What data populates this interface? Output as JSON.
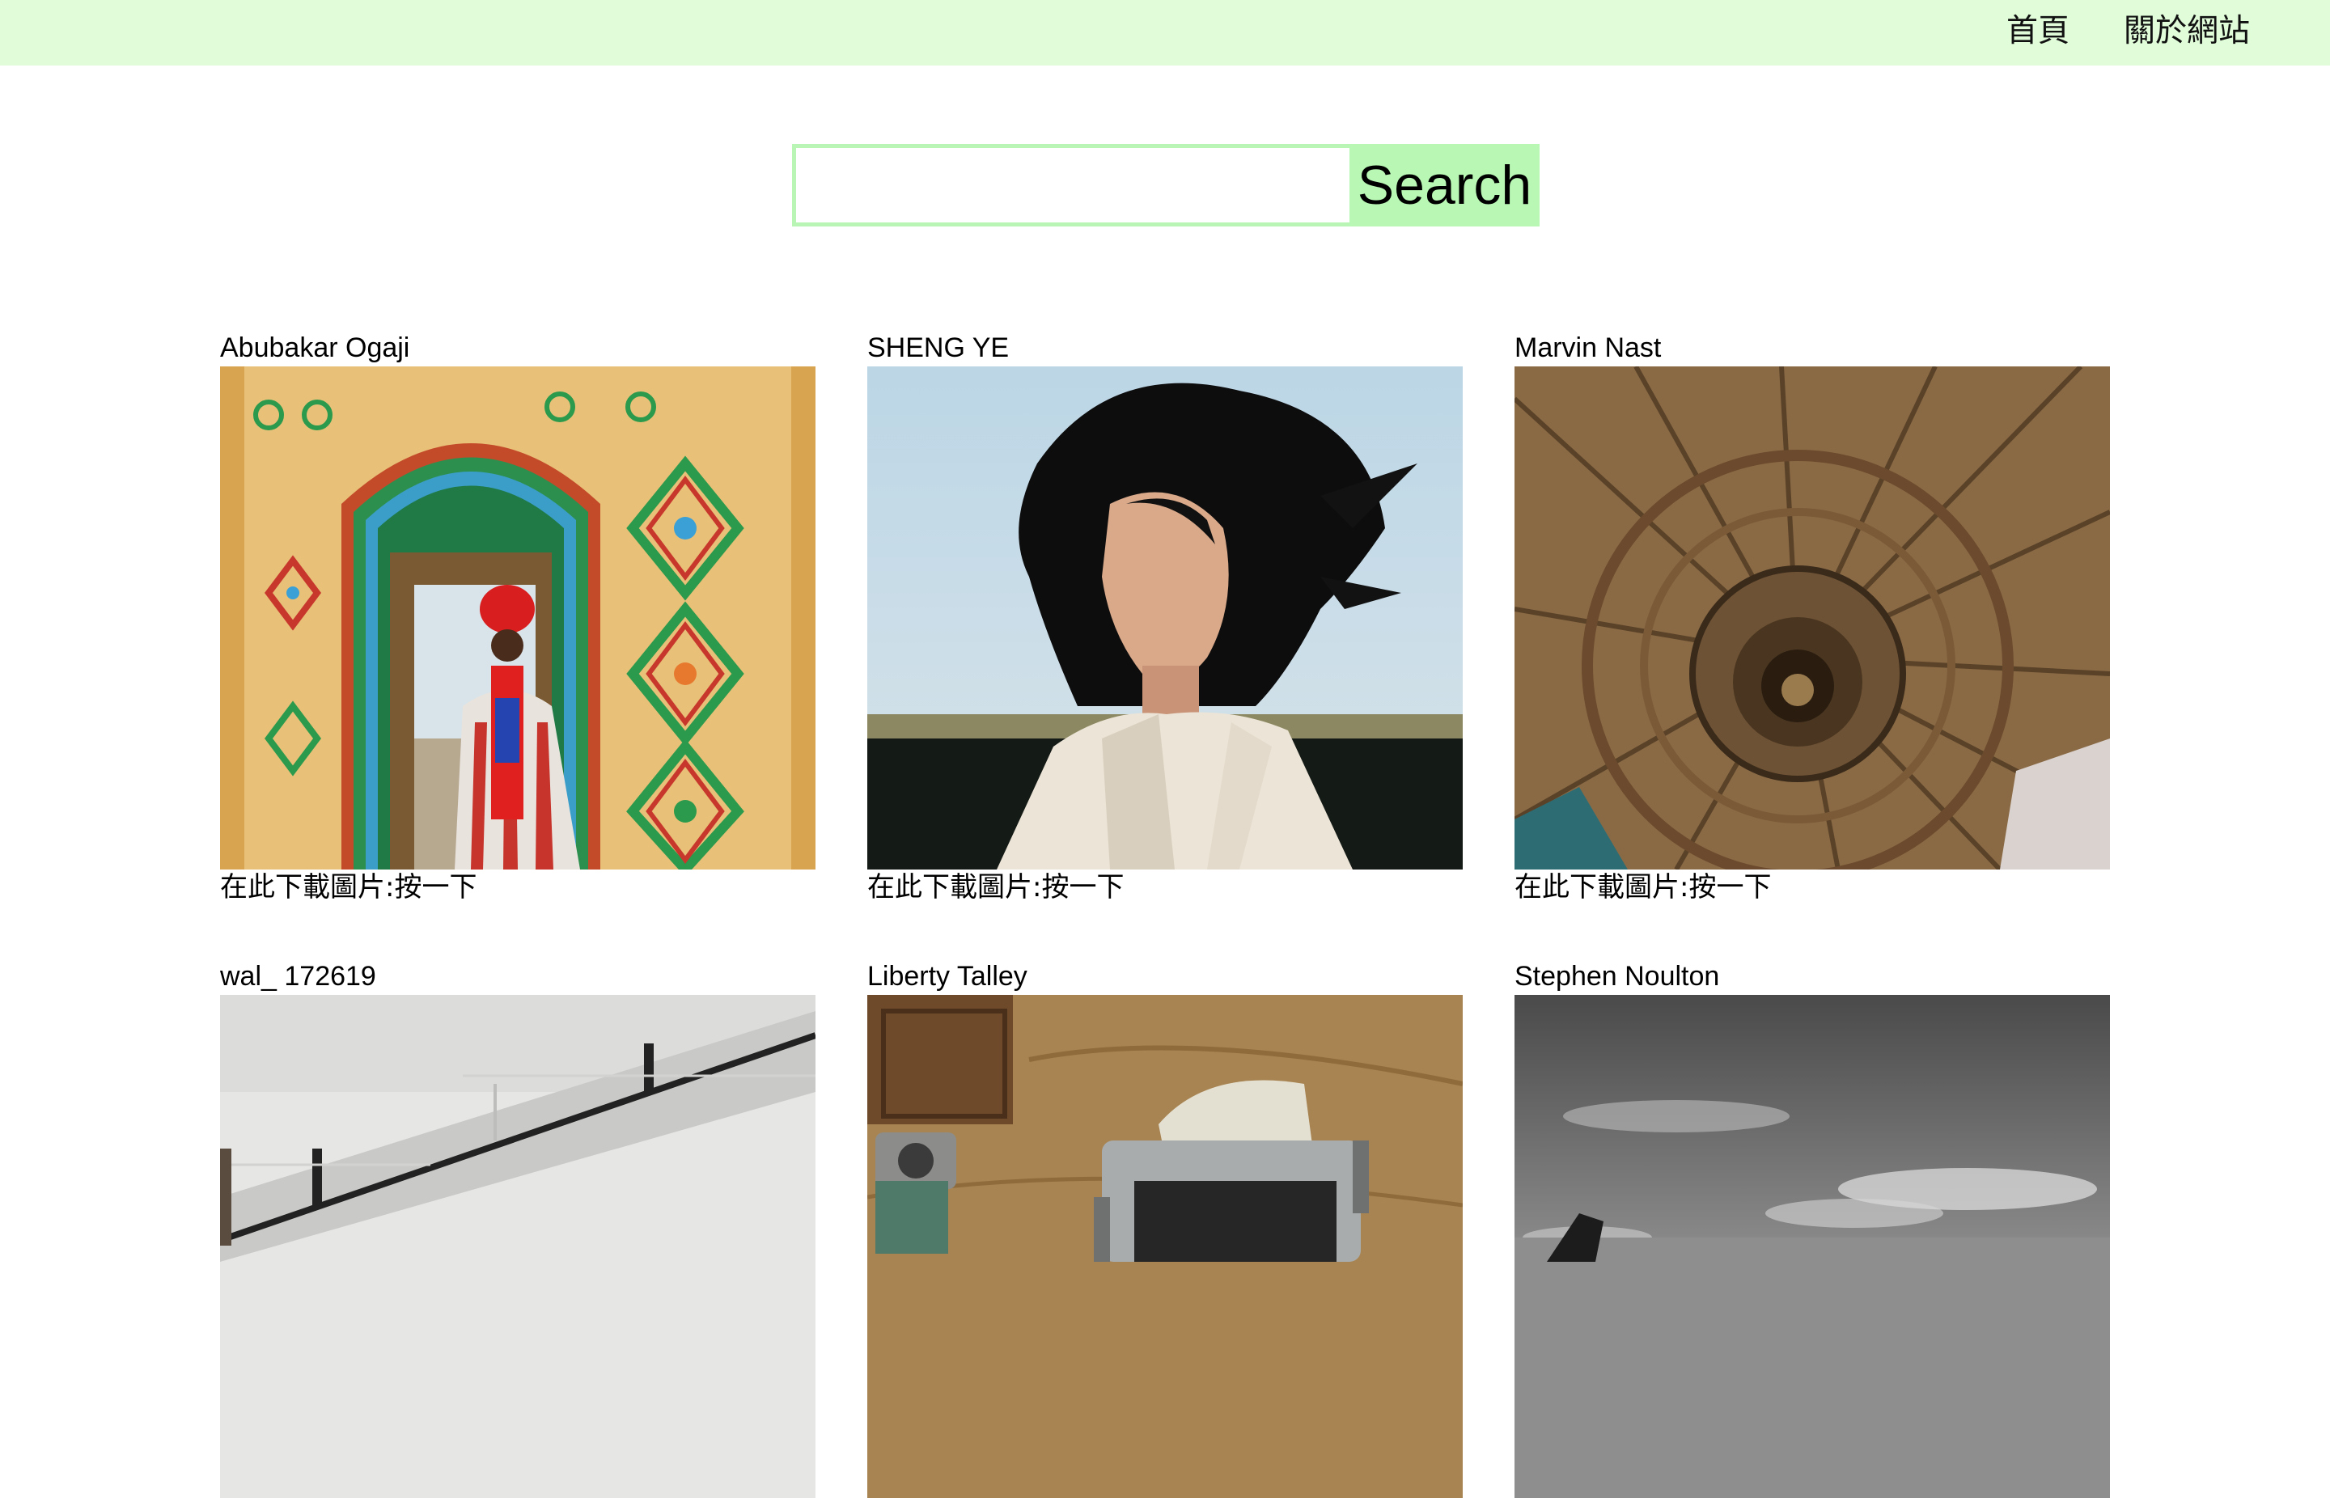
{
  "nav": {
    "home_label": "首頁",
    "about_label": "關於網站"
  },
  "search": {
    "value": "",
    "placeholder": "",
    "button_label": "Search"
  },
  "gallery": {
    "cards": [
      {
        "author": "Abubakar Ogaji",
        "download_label": "在此下載圖片:按一下",
        "photo": "ornate-doorway-man-in-red-turban"
      },
      {
        "author": "SHENG YE",
        "download_label": "在此下載圖片:按一下",
        "photo": "woman-windblown-hair-white-coat"
      },
      {
        "author": "Marvin Nast",
        "download_label": "在此下載圖片:按一下",
        "photo": "wooden-spiral-staircase"
      },
      {
        "author": "wal_ 172619",
        "photo": "white-concrete-stairs-railing"
      },
      {
        "author": "Liberty Talley",
        "photo": "typewriter-on-tan-blanket"
      },
      {
        "author": "Stephen Noulton",
        "photo": "black-white-seascape-rock"
      }
    ]
  },
  "colors": {
    "topbar_bg": "#e0fcd9",
    "search_border": "#b9f5b4",
    "search_button_bg": "#b9f7b4"
  }
}
